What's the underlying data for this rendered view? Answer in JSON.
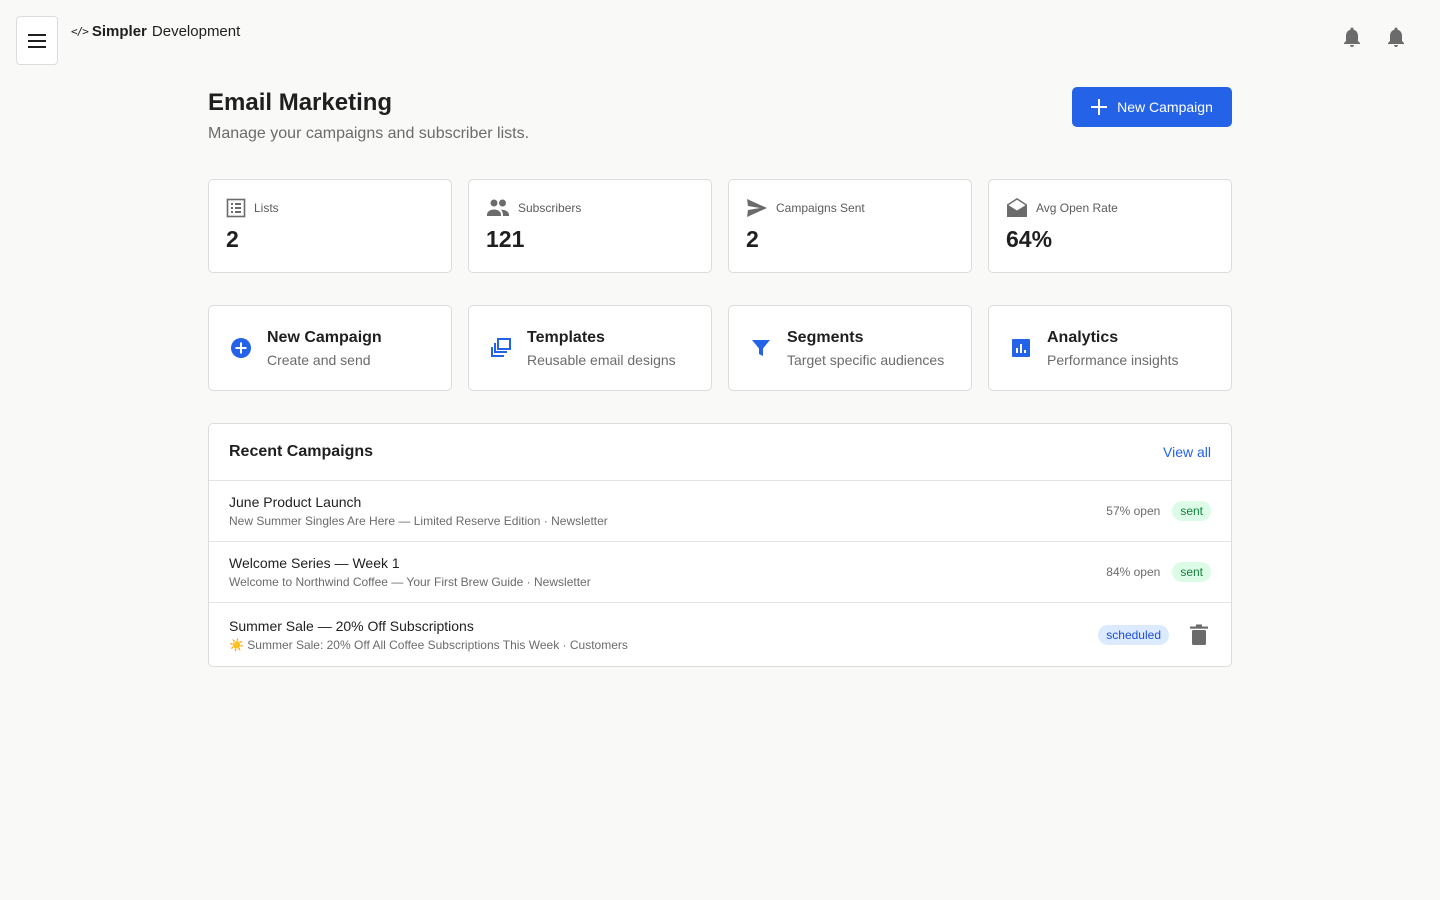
{
  "app": {
    "brand_code": "</>",
    "brand_bold": "Simpler",
    "brand_rest": "Development"
  },
  "header": {
    "title": "Email Marketing",
    "subtitle": "Manage your campaigns and subscriber lists.",
    "new_campaign_label": "New Campaign"
  },
  "stats": [
    {
      "label": "Lists",
      "value": "2",
      "icon": "list-icon"
    },
    {
      "label": "Subscribers",
      "value": "121",
      "icon": "people-icon"
    },
    {
      "label": "Campaigns Sent",
      "value": "2",
      "icon": "send-icon"
    },
    {
      "label": "Avg Open Rate",
      "value": "64%",
      "icon": "open-envelope-icon"
    }
  ],
  "actions": [
    {
      "title": "New Campaign",
      "subtitle": "Create and send",
      "icon": "add-circle-icon"
    },
    {
      "title": "Templates",
      "subtitle": "Reusable email designs",
      "icon": "templates-icon"
    },
    {
      "title": "Segments",
      "subtitle": "Target specific audiences",
      "icon": "filter-icon"
    },
    {
      "title": "Analytics",
      "subtitle": "Performance insights",
      "icon": "analytics-icon"
    }
  ],
  "recent": {
    "title": "Recent Campaigns",
    "view_all": "View all",
    "campaigns": [
      {
        "name": "June Product Launch",
        "meta": "New Summer Singles Are Here — Limited Reserve Edition · Newsletter",
        "open": "57% open",
        "status": "sent"
      },
      {
        "name": "Welcome Series — Week 1",
        "meta": "Welcome to Northwind Coffee — Your First Brew Guide · Newsletter",
        "open": "84% open",
        "status": "sent"
      },
      {
        "name": "Summer Sale — 20% Off Subscriptions",
        "meta": "☀️ Summer Sale: 20% Off All Coffee Subscriptions This Week · Customers",
        "open": "",
        "status": "scheduled"
      }
    ]
  },
  "colors": {
    "accent": "#2462e8",
    "background": "#f9f9f8",
    "sent_badge_bg": "#dcfce7",
    "scheduled_badge_bg": "#dbeafe"
  }
}
